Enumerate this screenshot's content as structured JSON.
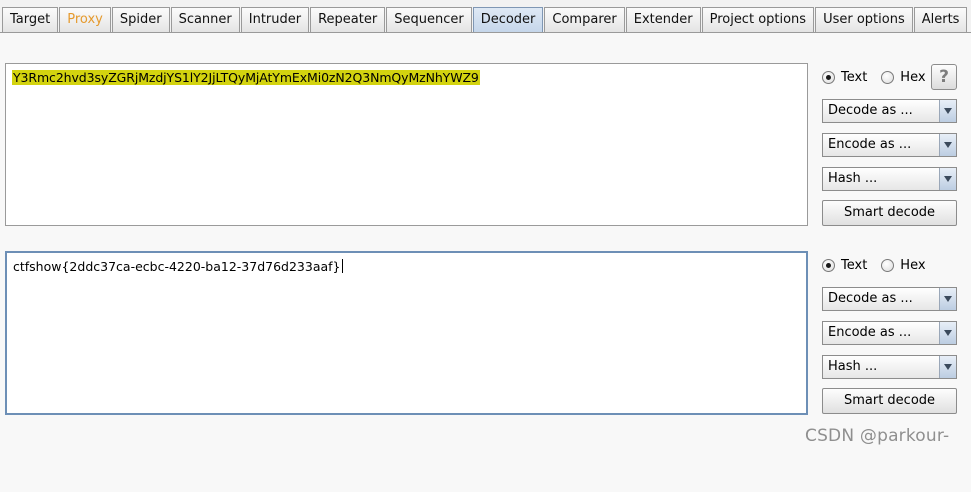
{
  "tabs": [
    {
      "label": "Target"
    },
    {
      "label": "Proxy"
    },
    {
      "label": "Spider"
    },
    {
      "label": "Scanner"
    },
    {
      "label": "Intruder"
    },
    {
      "label": "Repeater"
    },
    {
      "label": "Sequencer"
    },
    {
      "label": "Decoder"
    },
    {
      "label": "Comparer"
    },
    {
      "label": "Extender"
    },
    {
      "label": "Project options"
    },
    {
      "label": "User options"
    },
    {
      "label": "Alerts"
    }
  ],
  "active_tab": "Decoder",
  "colors": {
    "proxy_tab_text": "#e59a2e",
    "highlight": "#d3d30f"
  },
  "input_panel": {
    "text": "Y3Rmc2hvd3syZGRjMzdjYS1lY2JjLTQyMjAtYmExMi0zN2Q3NmQyMzNhYWZ9",
    "radio_text": "Text",
    "radio_hex": "Hex",
    "selected": "Text",
    "help_label": "?",
    "decode_as": "Decode as ...",
    "encode_as": "Encode as ...",
    "hash": "Hash ...",
    "smart_decode": "Smart decode"
  },
  "output_panel": {
    "text": "ctfshow{2ddc37ca-ecbc-4220-ba12-37d76d233aaf}",
    "radio_text": "Text",
    "radio_hex": "Hex",
    "selected": "Text",
    "decode_as": "Decode as ...",
    "encode_as": "Encode as ...",
    "hash": "Hash ...",
    "smart_decode": "Smart decode"
  },
  "watermark": "CSDN @parkour-"
}
